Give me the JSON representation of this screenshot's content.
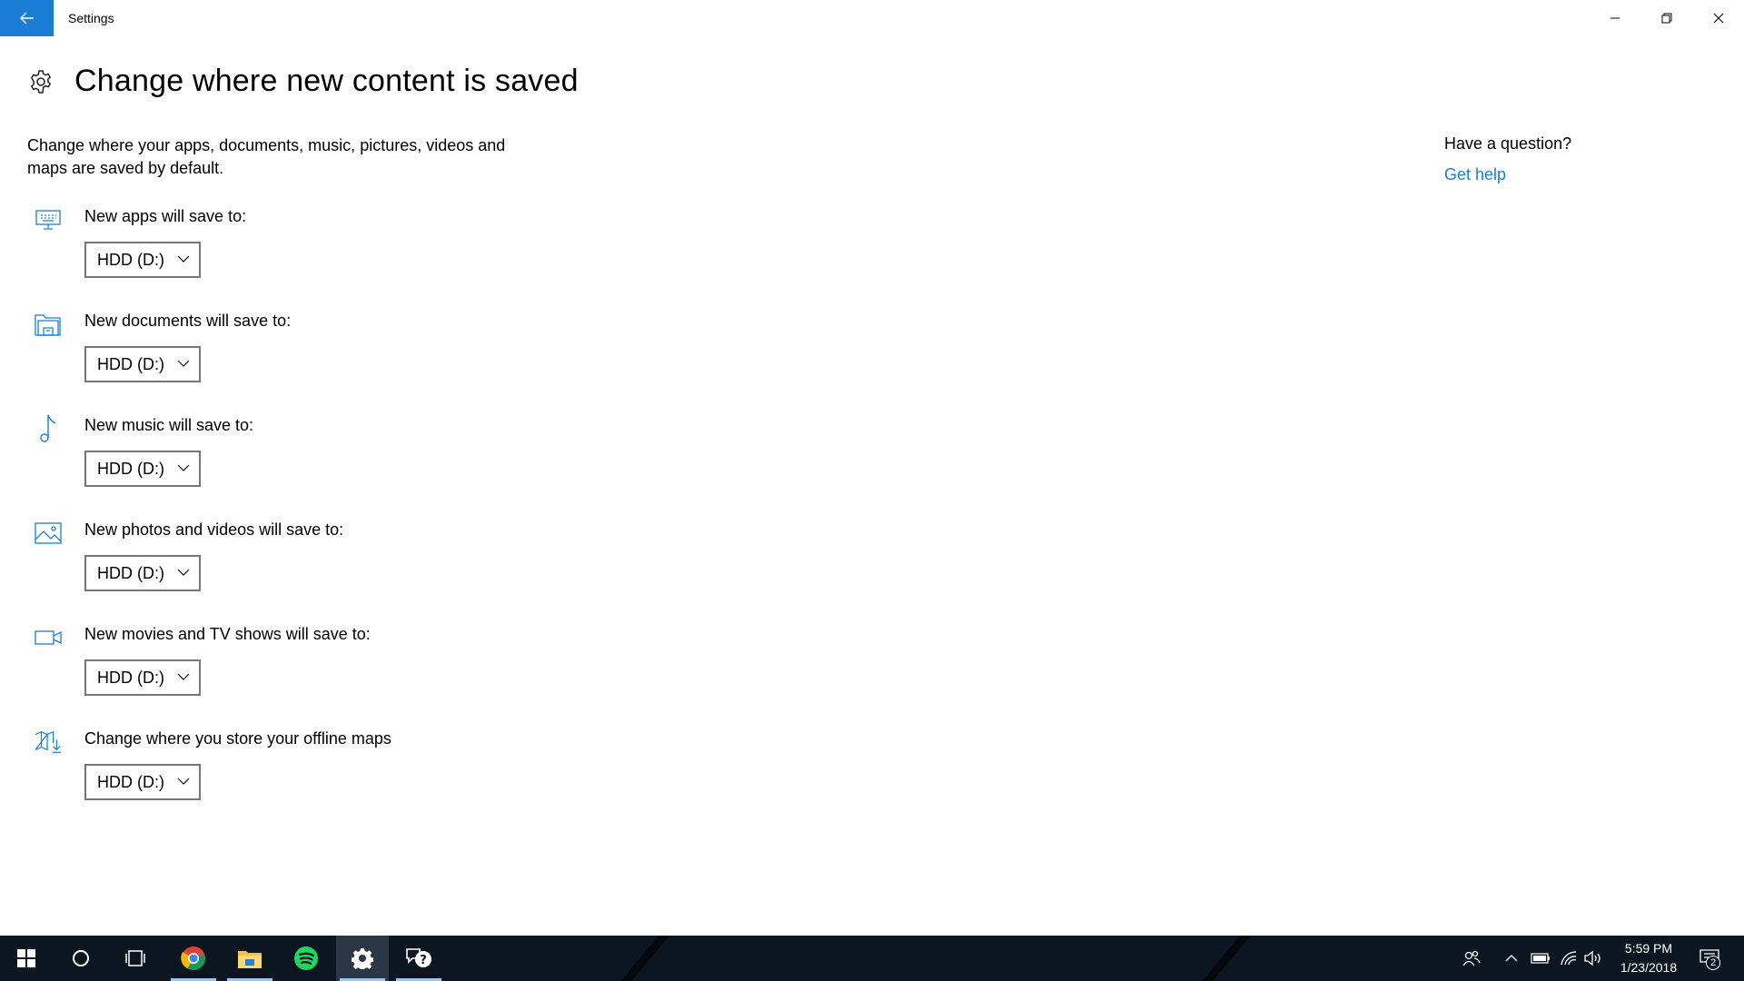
{
  "window": {
    "title": "Settings"
  },
  "header": {
    "title": "Change where new content is saved"
  },
  "description": "Change where your apps, documents, music, pictures, videos and maps are saved by default.",
  "settings": [
    {
      "label": "New apps will save to:",
      "value": "HDD (D:)",
      "icon": "monitor-icon"
    },
    {
      "label": "New documents will save to:",
      "value": "HDD (D:)",
      "icon": "documents-icon"
    },
    {
      "label": "New music will save to:",
      "value": "HDD (D:)",
      "icon": "music-note-icon"
    },
    {
      "label": "New photos and videos will save to:",
      "value": "HDD (D:)",
      "icon": "picture-icon"
    },
    {
      "label": "New movies and TV shows will save to:",
      "value": "HDD (D:)",
      "icon": "video-camera-icon"
    },
    {
      "label": "Change where you store your offline maps",
      "value": "HDD (D:)",
      "icon": "map-download-icon"
    }
  ],
  "help": {
    "question": "Have a question?",
    "link": "Get help"
  },
  "taskbar": {
    "apps": [
      "start-icon",
      "cortana-icon",
      "task-view-icon",
      "chrome-icon",
      "file-explorer-icon",
      "spotify-icon",
      "settings-icon",
      "feedback-hub-icon"
    ],
    "clock_time": "5:59 PM",
    "clock_date": "1/23/2018",
    "notification_count": "2"
  },
  "colors": {
    "accent": "#1a7ed6",
    "taskbar": "#0b1620"
  }
}
